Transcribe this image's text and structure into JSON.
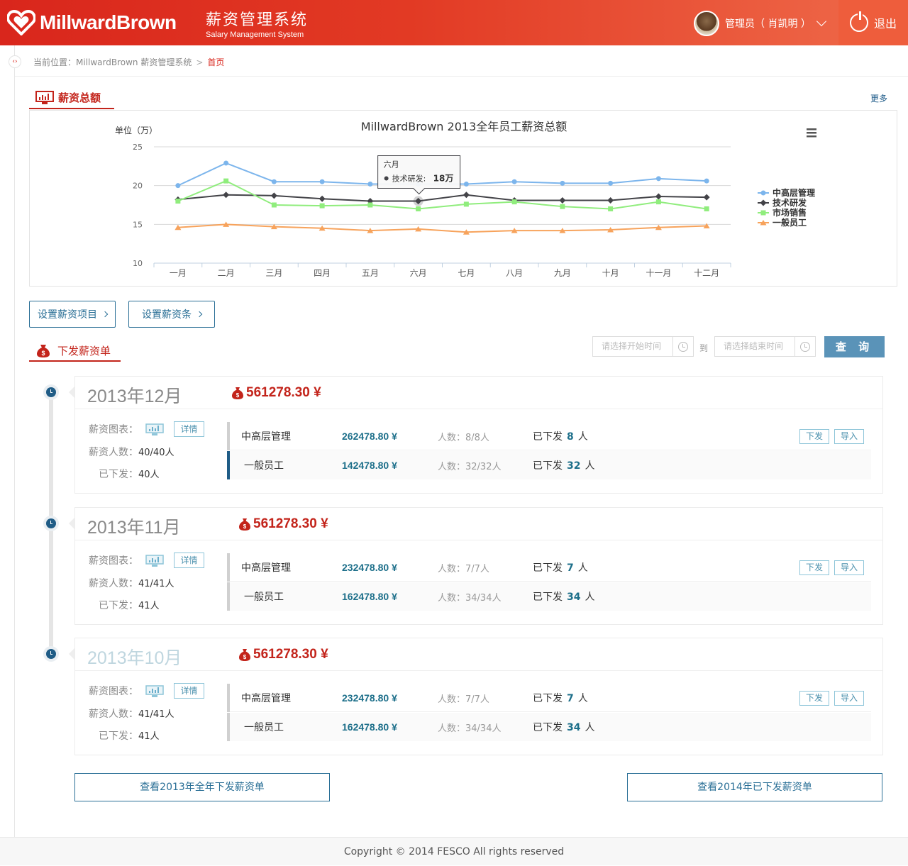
{
  "header": {
    "logo_text": "MillwardBrown",
    "system_title_cn": "薪资管理系统",
    "system_title_en": "Salary Management System",
    "user_label": "管理员（ 肖凯明 ）",
    "logout_label": "退出"
  },
  "breadcrumb": {
    "prefix": "当前位置：MillwardBrown 薪资管理系统",
    "current": "首页"
  },
  "salary_section": {
    "title": "薪资总额",
    "more_label": "更多"
  },
  "chart_data": {
    "type": "line",
    "title": "MillwardBrown 2013全年员工薪资总额",
    "ylabel": "单位（万）",
    "ylim": [
      10,
      25
    ],
    "yticks": [
      25,
      20,
      15,
      10
    ],
    "categories": [
      "一月",
      "二月",
      "三月",
      "四月",
      "五月",
      "六月",
      "七月",
      "八月",
      "九月",
      "十月",
      "十一月",
      "十二月"
    ],
    "series": [
      {
        "name": "中高层管理",
        "color": "#7cb5ec",
        "marker": "circle",
        "values": [
          20,
          22.9,
          20.5,
          20.5,
          20.2,
          20.2,
          20.2,
          20.5,
          20.3,
          20.3,
          20.9,
          20.6
        ]
      },
      {
        "name": "技术研发",
        "color": "#434348",
        "marker": "diamond",
        "values": [
          18.2,
          18.8,
          18.7,
          18.3,
          18,
          18,
          18.8,
          18.1,
          18.1,
          18.1,
          18.6,
          18.5
        ]
      },
      {
        "name": "市场销售",
        "color": "#90ed7d",
        "marker": "square",
        "values": [
          18,
          20.6,
          17.5,
          17.4,
          17.5,
          17,
          17.6,
          17.9,
          17.3,
          17,
          17.9,
          17
        ]
      },
      {
        "name": "一般员工",
        "color": "#f7a35c",
        "marker": "triangle",
        "values": [
          14.6,
          15,
          14.7,
          14.5,
          14.2,
          14.4,
          14,
          14.2,
          14.2,
          14.3,
          14.6,
          14.8
        ]
      }
    ],
    "legend_position": "right",
    "tooltip": {
      "category": "六月",
      "series": "技术研发",
      "label": "技术研发:",
      "value_text": "18万"
    },
    "menu_icon": "hamburger-menu-icon"
  },
  "actions": {
    "setup_items_label": "设置薪资项目",
    "setup_slip_label": "设置薪资条"
  },
  "payroll_section": {
    "title": "下发薪资单",
    "start_placeholder": "请选择开始时间",
    "to_label": "到",
    "end_placeholder": "请选择结束时间",
    "query_label": "查 询"
  },
  "months": [
    {
      "month": "2013年12月",
      "total": "561278.30 ¥",
      "chart_label": "薪资图表：",
      "detail_label": "详情",
      "count_label": "薪资人数：",
      "count_value": "40/40人",
      "issued_label": "已下发：",
      "issued_value": "40人",
      "rows": [
        {
          "name": "中高层管理",
          "amount": "262478.80 ¥",
          "count": "人数：8/8人",
          "done_prefix": "已下发",
          "done_num": "8",
          "done_suffix": "人"
        },
        {
          "name": "一般员工",
          "amount": "142478.80 ¥",
          "count": "人数：32/32人",
          "done_prefix": "已下发",
          "done_num": "32",
          "done_suffix": "人"
        }
      ],
      "issue_label": "下发",
      "import_label": "导入"
    },
    {
      "month": "2013年11月",
      "total": "561278.30 ¥",
      "chart_label": "薪资图表：",
      "detail_label": "详情",
      "count_label": "薪资人数：",
      "count_value": "41/41人",
      "issued_label": "已下发：",
      "issued_value": "41人",
      "rows": [
        {
          "name": "中高层管理",
          "amount": "232478.80 ¥",
          "count": "人数：7/7人",
          "done_prefix": "已下发",
          "done_num": "7",
          "done_suffix": "人"
        },
        {
          "name": "一般员工",
          "amount": "162478.80 ¥",
          "count": "人数：34/34人",
          "done_prefix": "已下发",
          "done_num": "34",
          "done_suffix": "人"
        }
      ],
      "issue_label": "下发",
      "import_label": "导入"
    },
    {
      "month": "2013年10月",
      "total": "561278.30 ¥",
      "chart_label": "薪资图表：",
      "detail_label": "详情",
      "count_label": "薪资人数：",
      "count_value": "41/41人",
      "issued_label": "已下发：",
      "issued_value": "41人",
      "rows": [
        {
          "name": "中高层管理",
          "amount": "232478.80 ¥",
          "count": "人数：7/7人",
          "done_prefix": "已下发",
          "done_num": "7",
          "done_suffix": "人"
        },
        {
          "name": "一般员工",
          "amount": "162478.80 ¥",
          "count": "人数：34/34人",
          "done_prefix": "已下发",
          "done_num": "34",
          "done_suffix": "人"
        }
      ],
      "issue_label": "下发",
      "import_label": "导入"
    }
  ],
  "footer_buttons": {
    "view_2013": "查看2013年全年下发薪资单",
    "view_2014": "查看2014年已下发薪资单"
  },
  "footer": {
    "copyright": "Copyright © 2014 FESCO All rights reserved"
  },
  "colors": {
    "brand_red": "#d9261c",
    "accent_blue": "#1d6f8a",
    "button_blue": "#5a93b8"
  }
}
